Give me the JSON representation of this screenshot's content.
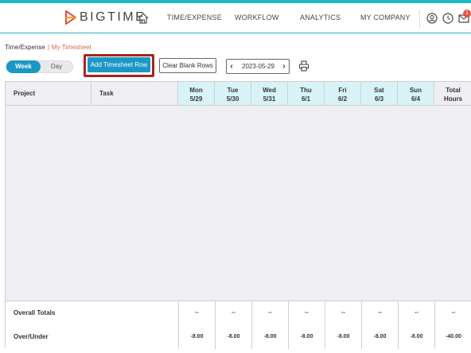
{
  "app": {
    "brand": "BIGTIME",
    "accent_color": "#1a97c4",
    "highlight_color": "#a8241c"
  },
  "nav": {
    "items": [
      "TIME/EXPENSE",
      "WORKFLOW",
      "ANALYTICS",
      "MY COMPANY"
    ],
    "icons": [
      "home-icon",
      "user-circle-icon",
      "clock-icon",
      "mail-icon"
    ],
    "notification_count": "1"
  },
  "breadcrumb": {
    "parent": "Time/Expense",
    "separator": "|",
    "current": "My Timesheet"
  },
  "view_toggle": {
    "options": [
      "Week",
      "Day"
    ],
    "selected": "Week"
  },
  "toolbar": {
    "add_row_label": "Add Timesheet Row",
    "clear_blank_label": "Clear Blank Rows",
    "date": "2023-05-29",
    "prev_label": "‹",
    "next_label": "›"
  },
  "timesheet": {
    "columns": {
      "project": "Project",
      "task": "Task",
      "total": [
        "Total",
        "Hours"
      ]
    },
    "days": [
      {
        "name": "Mon",
        "date": "5/29",
        "total": "--",
        "over_under": "-8.00"
      },
      {
        "name": "Tue",
        "date": "5/30",
        "total": "--",
        "over_under": "-8.00"
      },
      {
        "name": "Wed",
        "date": "5/31",
        "total": "--",
        "over_under": "-8.00"
      },
      {
        "name": "Thu",
        "date": "6/1",
        "total": "--",
        "over_under": "-8.00"
      },
      {
        "name": "Fri",
        "date": "6/2",
        "total": "--",
        "over_under": "-8.00"
      },
      {
        "name": "Sat",
        "date": "6/3",
        "total": "--",
        "over_under": "-8.00"
      },
      {
        "name": "Sun",
        "date": "6/4",
        "total": "--",
        "over_under": "-8.00"
      }
    ],
    "footer": {
      "overall_totals_label": "Overall Totals",
      "over_under_label": "Over/Under",
      "overall_total_hours": "--",
      "over_under_total": "-40.00"
    }
  }
}
